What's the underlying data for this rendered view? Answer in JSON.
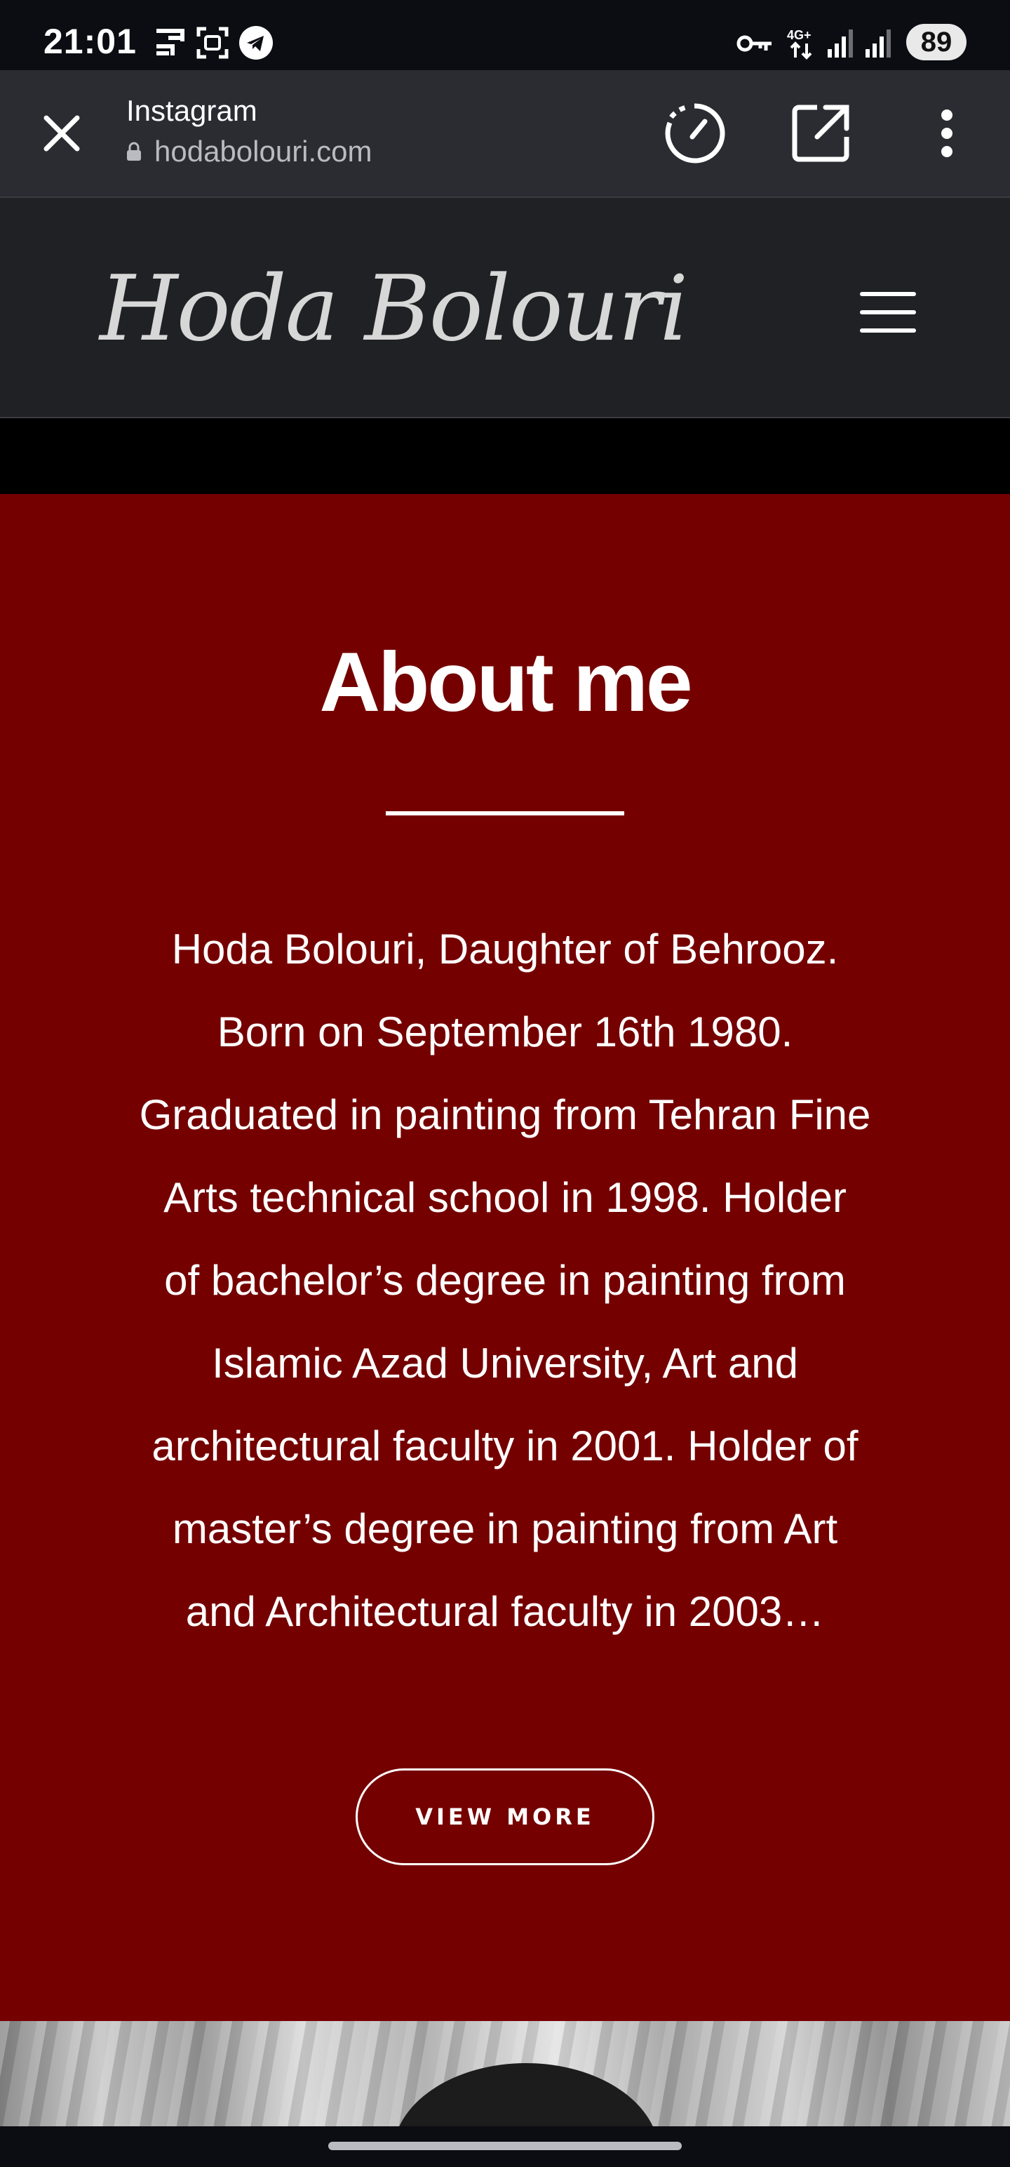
{
  "status_bar": {
    "time": "21:01",
    "battery": "89",
    "network": "4G+",
    "icons": [
      "cast-icon",
      "screenshot-icon",
      "telegram-icon",
      "vpn-key-icon",
      "network-4g-icon",
      "signal-icon",
      "signal-icon-2",
      "battery-icon"
    ]
  },
  "browser": {
    "title": "Instagram",
    "url": "hodabolouri.com",
    "icons": [
      "close-icon",
      "lock-icon",
      "data-saver-icon",
      "open-external-icon",
      "more-vert-icon"
    ]
  },
  "site": {
    "logo": "Hoda Bolouri",
    "menu_icon": "hamburger-icon"
  },
  "about": {
    "title": "About me",
    "text": "Hoda Bolouri, Daughter of Behrooz.\nBorn on September 16th 1980.\nGraduated in painting from Tehran Fine\nArts technical school in 1998. Holder\nof bachelor’s degree in painting from\nIslamic Azad University, Art and\narchitectural faculty in 2001. Holder of\nmaster’s degree in painting from Art\nand Architectural faculty in 2003…",
    "button_label": "VIEW MORE"
  },
  "colors": {
    "status_bg": "#0b0d12",
    "browser_bar": "#2a2c31",
    "header_bg": "#202124",
    "about_bg": "#750000",
    "text": "#ffffff"
  }
}
